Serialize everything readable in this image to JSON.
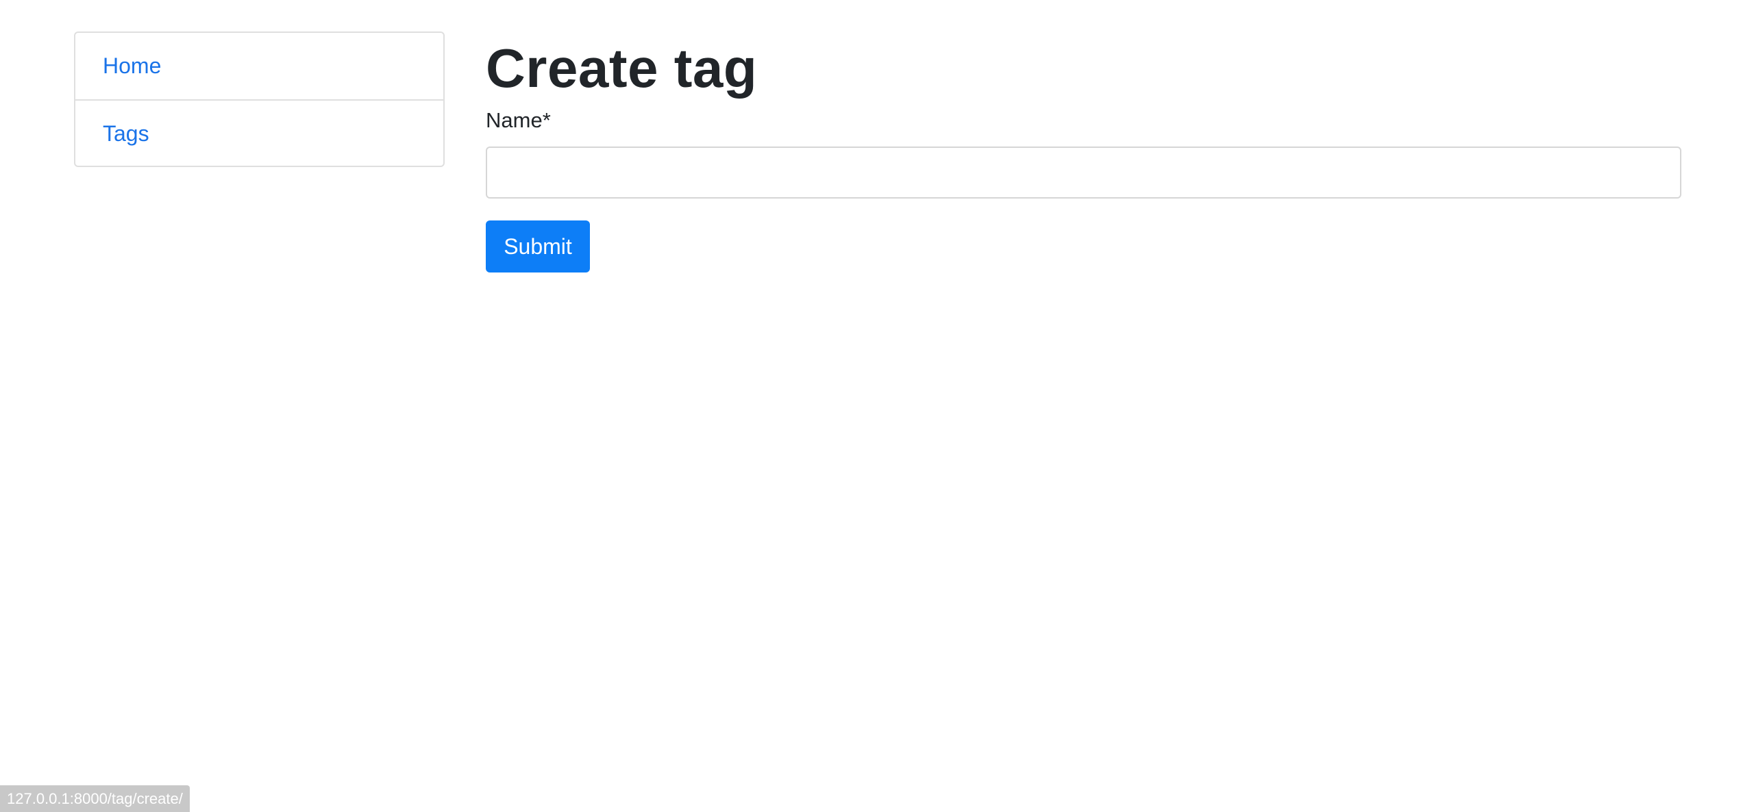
{
  "sidebar": {
    "items": [
      {
        "label": "Home"
      },
      {
        "label": "Tags"
      }
    ]
  },
  "main": {
    "title": "Create tag",
    "form": {
      "name_label": "Name*",
      "name_value": "",
      "name_placeholder": "",
      "submit_label": "Submit"
    }
  },
  "status_bar": {
    "url": "127.0.0.1:8000/tag/create/"
  },
  "colors": {
    "link": "#1a73e8",
    "primary_button": "#0d7ef7",
    "text": "#212529",
    "border": "#dfdfdf"
  }
}
